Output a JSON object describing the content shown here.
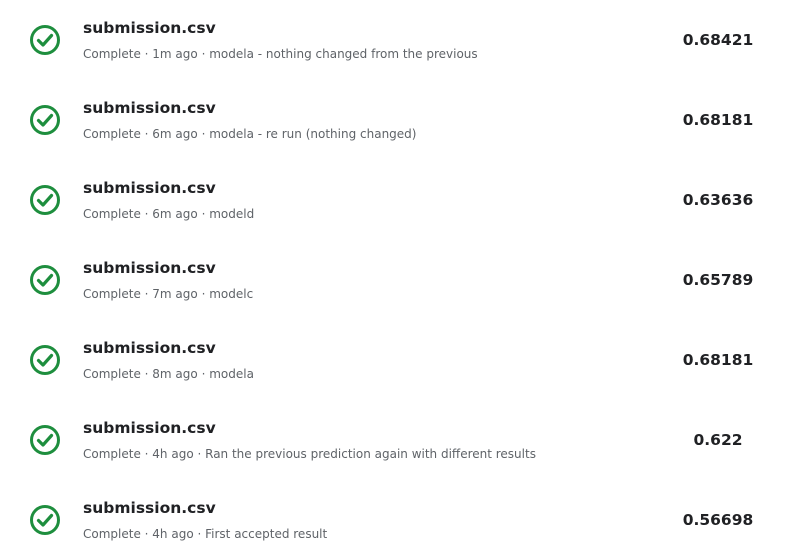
{
  "submissions": [
    {
      "file": "submission.csv",
      "status": "Complete",
      "time": "1m ago",
      "description": "modela - nothing changed from the previous",
      "score": "0.68421"
    },
    {
      "file": "submission.csv",
      "status": "Complete",
      "time": "6m ago",
      "description": "modela - re run (nothing changed)",
      "score": "0.68181"
    },
    {
      "file": "submission.csv",
      "status": "Complete",
      "time": "6m ago",
      "description": "modeld",
      "score": "0.63636"
    },
    {
      "file": "submission.csv",
      "status": "Complete",
      "time": "7m ago",
      "description": "modelc",
      "score": "0.65789"
    },
    {
      "file": "submission.csv",
      "status": "Complete",
      "time": "8m ago",
      "description": "modela",
      "score": "0.68181"
    },
    {
      "file": "submission.csv",
      "status": "Complete",
      "time": "4h ago",
      "description": "Ran the previous prediction again with different results",
      "score": "0.622"
    },
    {
      "file": "submission.csv",
      "status": "Complete",
      "time": "4h ago",
      "description": "First accepted result",
      "score": "0.56698"
    }
  ],
  "colors": {
    "success": "#1e8e3e",
    "text": "#202124",
    "muted": "#5f6368"
  },
  "icons": {
    "status": "check-circle-icon"
  }
}
